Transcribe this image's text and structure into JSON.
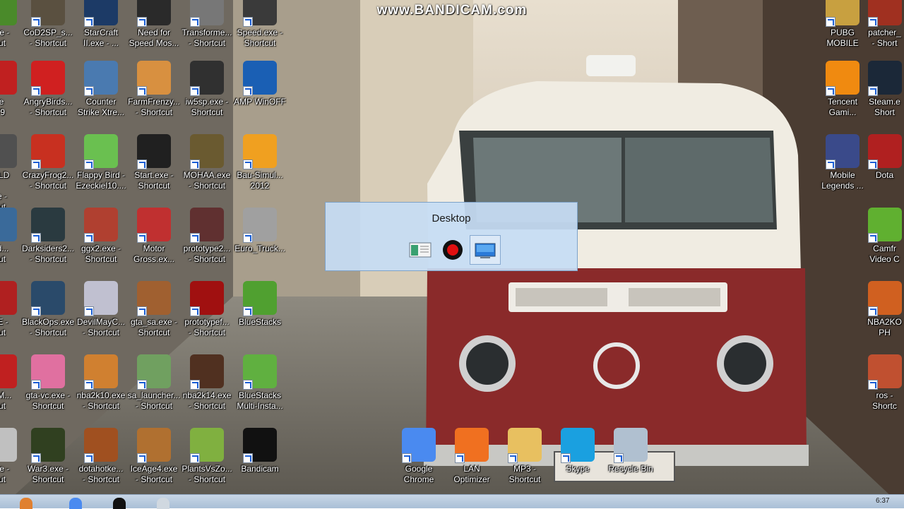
{
  "watermark": "www.BANDICAM.com",
  "popup": {
    "title": "Desktop",
    "buttons": [
      {
        "name": "window-mode-icon",
        "selected": false
      },
      {
        "name": "record-icon",
        "selected": false
      },
      {
        "name": "desktop-mode-icon",
        "selected": true
      }
    ]
  },
  "icons": [
    {
      "label": "exe -\ncut",
      "name": "cut-off-icon",
      "color": "#4a8a2a"
    },
    {
      "label": "CoD2SP_s...\n- Shortcut",
      "name": "cod2-icon",
      "color": "#5a5040"
    },
    {
      "label": "StarCraft\nII.exe - ...",
      "name": "starcraft-icon",
      "color": "#1c3a66"
    },
    {
      "label": "Need for\nSpeed Mos...",
      "name": "nfs-icon",
      "color": "#2a2a2a"
    },
    {
      "label": "Transforme...\n- Shortcut",
      "name": "transformers-icon",
      "color": "#777777"
    },
    {
      "label": "Speed.exe -\nShortcut",
      "name": "speed-icon",
      "color": "#3a3a3a"
    },
    {
      "label": "PUBG\nMOBILE",
      "name": "pubg-icon",
      "color": "#c8a040"
    },
    {
      "label": "patcher_\n- Short",
      "name": "patcher-icon",
      "color": "#a03020"
    },
    {
      "label": "re\nr 9",
      "name": "cut-off-icon",
      "color": "#c02020"
    },
    {
      "label": "AngryBirds...\n- Shortcut",
      "name": "angry-birds-icon",
      "color": "#d02020"
    },
    {
      "label": "Counter\nStrike Xtre...",
      "name": "counter-strike-icon",
      "color": "#4a7ab0"
    },
    {
      "label": "FarmFrenzy...\n- Shortcut",
      "name": "farm-frenzy-icon",
      "color": "#d89040"
    },
    {
      "label": "iw5sp.exe -\nShortcut",
      "name": "mw3-icon",
      "color": "#303030"
    },
    {
      "label": "AMP WinOFF",
      "name": "power-icon",
      "color": "#1a5fb4"
    },
    {
      "label": "Tencent\nGami...",
      "name": "tencent-icon",
      "color": "#f08a10"
    },
    {
      "label": "Steam.e\nShort",
      "name": "steam-icon",
      "color": "#1b2838"
    },
    {
      "label": "IELD\n\nxe -\ncut",
      "name": "cut-off-icon",
      "color": "#505050"
    },
    {
      "label": "CrazyFrog2...\n- Shortcut",
      "name": "crazy-frog-icon",
      "color": "#c83020"
    },
    {
      "label": "Flappy Bird -\nEzeckiel10....",
      "name": "flappy-bird-icon",
      "color": "#6ac050"
    },
    {
      "label": "Start.exe -\nShortcut",
      "name": "thps-icon",
      "color": "#202020"
    },
    {
      "label": "MOHAA.exe\n- Shortcut",
      "name": "mohaa-icon",
      "color": "#6a5a30"
    },
    {
      "label": "Bau-Simul...\n2012",
      "name": "helmet-icon",
      "color": "#f0a020"
    },
    {
      "label": "Mobile\nLegends ...",
      "name": "mobile-legends-icon",
      "color": "#3a4a8a"
    },
    {
      "label": "Dota",
      "name": "dota-icon",
      "color": "#b02020"
    },
    {
      "label": "Ad...\ncut",
      "name": "cut-off-icon",
      "color": "#3a6a9a"
    },
    {
      "label": "Darksiders2...\n- Shortcut",
      "name": "darksiders-icon",
      "color": "#2a3a40"
    },
    {
      "label": "ggx2.exe -\nShortcut",
      "name": "ggx2-icon",
      "color": "#b04030"
    },
    {
      "label": "Motor\nGross.ex...",
      "name": "motor-gross-icon",
      "color": "#c03030"
    },
    {
      "label": "prototype2...\n- Shortcut",
      "name": "prototype2-icon",
      "color": "#603030"
    },
    {
      "label": "Euro_Truck...",
      "name": "truck-icon",
      "color": "#a0a0a0"
    },
    {
      "label": "Camfr\nVideo C",
      "name": "camfrog-icon",
      "color": "#60b030"
    },
    {
      "label": "XE -\ncut",
      "name": "cut-off-icon",
      "color": "#b02020"
    },
    {
      "label": "BlackOps.exe\n- Shortcut",
      "name": "black-ops-icon",
      "color": "#2a4a6a"
    },
    {
      "label": "DevilMayC...\n- Shortcut",
      "name": "devil-may-cry-icon",
      "color": "#c0c0d0"
    },
    {
      "label": "gta_sa.exe -\nShortcut",
      "name": "gta-sa-icon",
      "color": "#a06030"
    },
    {
      "label": "prototypef...\n- Shortcut",
      "name": "prototype-icon",
      "color": "#a01010"
    },
    {
      "label": "BlueStacks",
      "name": "bluestacks-icon",
      "color": "#50a030"
    },
    {
      "label": "NBA2KO\nPH",
      "name": "nba-ball-icon",
      "color": "#d06020"
    },
    {
      "label": "psM...\ncut",
      "name": "cut-off-icon",
      "color": "#c02020"
    },
    {
      "label": "gta-vc.exe -\nShortcut",
      "name": "gta-vc-icon",
      "color": "#e070a0"
    },
    {
      "label": "nba2k10.exe\n- Shortcut",
      "name": "nba2k10-icon",
      "color": "#d08030"
    },
    {
      "label": "sa_launcher...\n- Shortcut",
      "name": "sa-launcher-icon",
      "color": "#70a060"
    },
    {
      "label": "nba2k14.exe\n- Shortcut",
      "name": "nba2k14-icon",
      "color": "#503020"
    },
    {
      "label": "BlueStacks\nMulti-Insta...",
      "name": "bluestacks-multi-icon",
      "color": "#60b040"
    },
    {
      "label": "ros -\nShortc",
      "name": "ros-icon",
      "color": "#c05030"
    },
    {
      "label": "exe -\ncut",
      "name": "cut-off-icon",
      "color": "#c0c0c0"
    },
    {
      "label": "War3.exe -\nShortcut",
      "name": "warcraft3-icon",
      "color": "#304020"
    },
    {
      "label": "dotahotke...\n- Shortcut",
      "name": "dota-hotkey-icon",
      "color": "#a05020"
    },
    {
      "label": "IceAge4.exe\n- Shortcut",
      "name": "ice-age-icon",
      "color": "#b07030"
    },
    {
      "label": "PlantsVsZo...\n- Shortcut",
      "name": "plants-vs-zombies-icon",
      "color": "#80b040"
    },
    {
      "label": "Bandicam",
      "name": "bandicam-icon",
      "color": "#111111"
    },
    {
      "label": "Google\nChrome",
      "name": "chrome-icon",
      "color": "#4a8af0"
    },
    {
      "label": "LAN\nOptimizer",
      "name": "lan-optimizer-icon",
      "color": "#f07020"
    },
    {
      "label": "MP3 -\nShortcut",
      "name": "folder-icon",
      "color": "#e8c060"
    },
    {
      "label": "Skype",
      "name": "skype-icon",
      "color": "#1aa0e0"
    },
    {
      "label": "Recycle Bin",
      "name": "recycle-bin-icon",
      "color": "#b0c0d0"
    }
  ],
  "taskbar": {
    "buttons": [
      {
        "name": "taskbar-explorer-icon",
        "color": "#e08030"
      },
      {
        "name": "taskbar-chrome-icon",
        "color": "#4a8af0"
      },
      {
        "name": "taskbar-bandicam-icon",
        "color": "#111111"
      },
      {
        "name": "taskbar-window-icon",
        "color": "#d0d8e0"
      }
    ],
    "clock": "6:37"
  }
}
